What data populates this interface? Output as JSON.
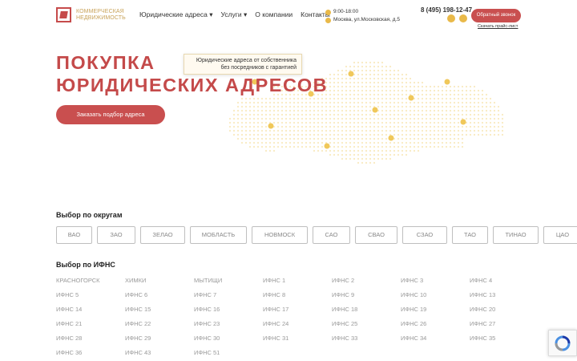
{
  "header": {
    "logo_line1": "КОММЕРЧЕСКАЯ",
    "logo_line2": "НЕДВИЖИМОСТЬ",
    "nav": [
      "Юридические адреса ▾",
      "Услуги ▾",
      "О компании",
      "Контакты"
    ],
    "hours": "9:00-18:00",
    "address": "Москва, ул.Московская, д.5",
    "phone": "8 (495) 198-12-47",
    "callback_label": "Обратный звонок",
    "pricelist_label": "Скачать прайс-лист"
  },
  "hero": {
    "title_line1": "ПОКУПКА",
    "title_line2": "ЮРИДИЧЕСКИХ АДРЕСОВ",
    "tooltip_line1": "Юридические адреса от собственника",
    "tooltip_line2": "без посредников с гарантией",
    "button_label": "Заказать подбор адреса"
  },
  "districts": {
    "heading": "Выбор по округам",
    "items": [
      "ВАО",
      "ЗАО",
      "ЗЕЛАО",
      "МОБЛАСТЬ",
      "НОВМОСК",
      "САО",
      "СВАО",
      "СЗАО",
      "ТАО",
      "ТИНАО",
      "ЦАО"
    ]
  },
  "ifns": {
    "heading": "Выбор по ИФНС",
    "items": [
      "КРАСНОГОРСК",
      "ХИМКИ",
      "МЫТИЩИ",
      "ИФНС 1",
      "ИФНС 2",
      "ИФНС 3",
      "ИФНС 4",
      "ИФНС 5",
      "ИФНС 6",
      "ИФНС 7",
      "ИФНС 8",
      "ИФНС 9",
      "ИФНС 10",
      "ИФНС 13",
      "ИФНС 14",
      "ИФНС 15",
      "ИФНС 16",
      "ИФНС 17",
      "ИФНС 18",
      "ИФНС 19",
      "ИФНС 20",
      "ИФНС 21",
      "ИФНС 22",
      "ИФНС 23",
      "ИФНС 24",
      "ИФНС 25",
      "ИФНС 26",
      "ИФНС 27",
      "ИФНС 28",
      "ИФНС 29",
      "ИФНС 30",
      "ИФНС 31",
      "ИФНС 33",
      "ИФНС 34",
      "ИФНС 35",
      "ИФНС 36",
      "ИФНС 43",
      "ИФНС 51"
    ]
  },
  "colors": {
    "accent": "#c94f4f",
    "gold": "#e9b949"
  }
}
